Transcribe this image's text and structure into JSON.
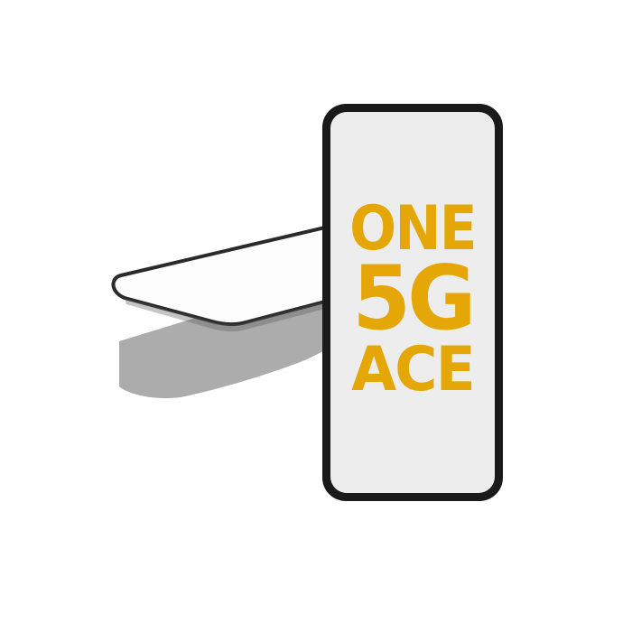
{
  "product": {
    "screen_text": {
      "line1": "ONE",
      "line2": "5G",
      "line3": "ACE"
    },
    "text_color": "#e4a707",
    "phone_frame_color": "#1a1a1a",
    "screen_color": "#ededed",
    "protector_border_color": "#2a2a2a",
    "protector_shadow_color": "#9e9e9e"
  }
}
